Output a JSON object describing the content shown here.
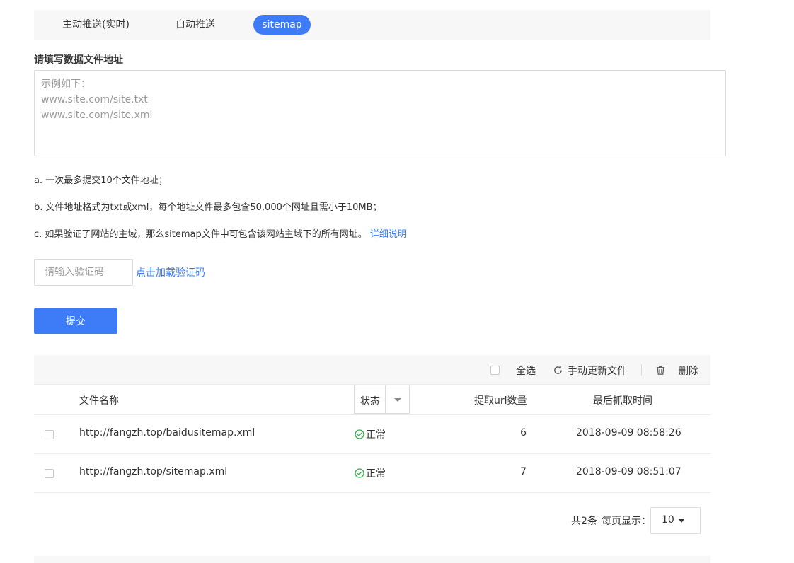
{
  "tabs": [
    {
      "label": "主动推送(实时)"
    },
    {
      "label": "自动推送"
    },
    {
      "label": "sitemap"
    }
  ],
  "form": {
    "field_title": "请填写数据文件地址",
    "textarea_placeholder": "示例如下：\nwww.site.com/site.txt\nwww.site.com/site.xml",
    "notes": [
      "a. 一次最多提交10个文件地址；",
      "b. 文件地址格式为txt或xml，每个地址文件最多包含50,000个网址且需小于10MB；",
      "c. 如果验证了网站的主域，那么sitemap文件中可包含该网站主域下的所有网址。"
    ],
    "detail_link": "详细说明",
    "captcha_placeholder": "请输入验证码",
    "captcha_link": "点击加载验证码",
    "submit_label": "提交"
  },
  "toolbar": {
    "select_all": "全选",
    "refresh": "手动更新文件",
    "delete": "删除"
  },
  "table": {
    "headers": {
      "name": "文件名称",
      "status": "状态",
      "count": "提取url数量",
      "time": "最后抓取时间"
    },
    "rows": [
      {
        "name": "http://fangzh.top/baidusitemap.xml",
        "status": "正常",
        "count": "6",
        "time": "2018-09-09 08:58:26"
      },
      {
        "name": "http://fangzh.top/sitemap.xml",
        "status": "正常",
        "count": "7",
        "time": "2018-09-09 08:51:07"
      }
    ]
  },
  "pager": {
    "total": "共2条",
    "per_page_label": "每页显示：",
    "per_page_value": "10"
  },
  "colors": {
    "accent": "#3d7cf6",
    "status_ok": "#2eb14a"
  }
}
